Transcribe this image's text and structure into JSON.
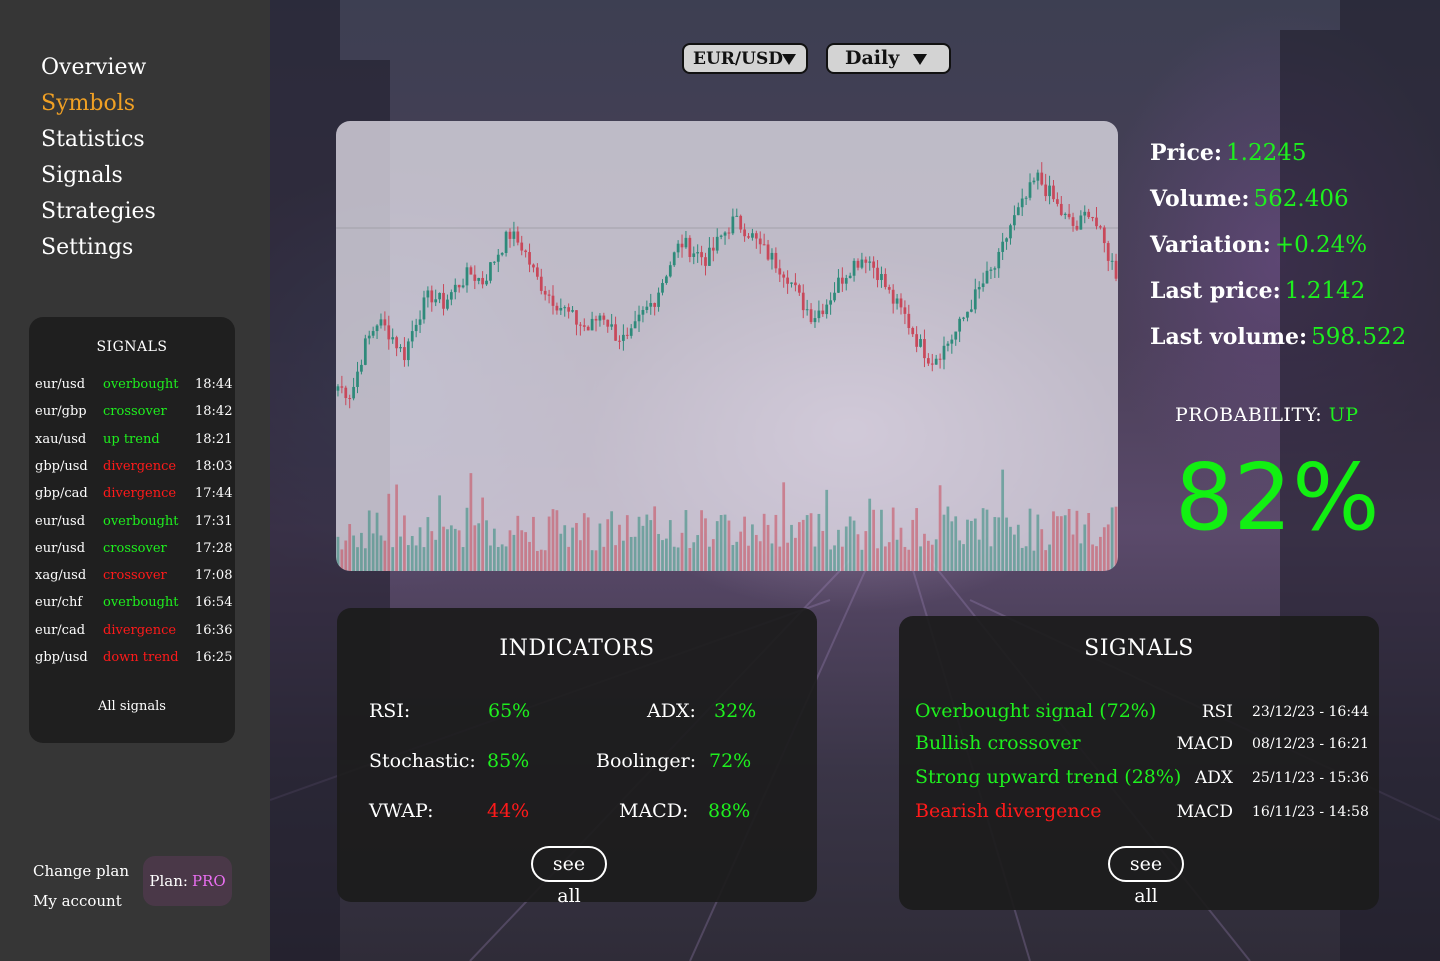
{
  "nav": {
    "items": [
      "Overview",
      "Symbols",
      "Statistics",
      "Signals",
      "Strategies",
      "Settings"
    ]
  },
  "sidebar_signals": {
    "title": "SIGNALS",
    "rows": [
      {
        "pair": "eur/usd",
        "type": "overbought",
        "time": "18:44",
        "color": "#1ef01e"
      },
      {
        "pair": "eur/gbp",
        "type": "crossover",
        "time": "18:42",
        "color": "#1ef01e"
      },
      {
        "pair": "xau/usd",
        "type": "up trend",
        "time": "18:21",
        "color": "#1ef01e"
      },
      {
        "pair": "gbp/usd",
        "type": "divergence",
        "time": "18:03",
        "color": "#ff1a1a"
      },
      {
        "pair": "gbp/cad",
        "type": "divergence",
        "time": "17:44",
        "color": "#ff1a1a"
      },
      {
        "pair": "eur/usd",
        "type": "overbought",
        "time": "17:31",
        "color": "#1ef01e"
      },
      {
        "pair": "eur/usd",
        "type": "crossover",
        "time": "17:28",
        "color": "#1ef01e"
      },
      {
        "pair": "xag/usd",
        "type": "crossover",
        "time": "17:08",
        "color": "#ff1a1a"
      },
      {
        "pair": "eur/chf",
        "type": "overbought",
        "time": "16:54",
        "color": "#1ef01e"
      },
      {
        "pair": "eur/cad",
        "type": "divergence",
        "time": "16:36",
        "color": "#ff1a1a"
      },
      {
        "pair": "gbp/usd",
        "type": "down trend",
        "time": "16:25",
        "color": "#ff1a1a"
      }
    ],
    "all_label": "All signals"
  },
  "account": {
    "change_plan": "Change plan",
    "my_account": "My account",
    "plan_label": "Plan:",
    "plan_value": "PRO"
  },
  "selectors": {
    "symbol": "EUR/USD",
    "timeframe": "Daily"
  },
  "stats": {
    "price_label": "Price:",
    "price": "1.2245",
    "volume_label": "Volume:",
    "volume": "562.406",
    "variation_label": "Variation:",
    "variation": "+0.24%",
    "last_price_label": "Last price:",
    "last_price": "1.2142",
    "last_volume_label": "Last volume:",
    "last_volume": "598.522"
  },
  "probability": {
    "label": "PROBABILITY:",
    "direction": "UP",
    "value": "82%"
  },
  "indicators": {
    "title": "INDICATORS",
    "rsi_label": "RSI:",
    "rsi": "65%",
    "adx_label": "ADX:",
    "adx": "32%",
    "stoch_label": "Stochastic:",
    "stoch": "85%",
    "boll_label": "Boolinger:",
    "boll": "72%",
    "vwap_label": "VWAP:",
    "vwap": "44%",
    "macd_label": "MACD:",
    "macd": "88%",
    "see_all": "see all"
  },
  "signals_panel": {
    "title": "SIGNALS",
    "rows": [
      {
        "text": "Overbought signal (72%)",
        "indicator": "RSI",
        "date": "23/12/23 - 16:44",
        "color": "#1ef01e"
      },
      {
        "text": "Bullish crossover",
        "indicator": "MACD",
        "date": "08/12/23 - 16:21",
        "color": "#1ef01e"
      },
      {
        "text": "Strong upward trend (28%)",
        "indicator": "ADX",
        "date": "25/11/23 - 15:36",
        "color": "#1ef01e"
      },
      {
        "text": "Bearish divergence",
        "indicator": "MACD",
        "date": "16/11/23 - 14:58",
        "color": "#ff1a1a"
      }
    ],
    "see_all": "see all"
  },
  "colors": {
    "accent": "#f0a024",
    "up": "#1ef01e",
    "down": "#ff1a1a",
    "pro": "#e96ef0"
  },
  "chart_data": {
    "type": "candlestick",
    "symbol": "EUR/USD",
    "timeframe": "1D",
    "x_count": 200,
    "close_path": [
      1.08,
      1.078,
      1.089,
      1.095,
      1.092,
      1.087,
      1.096,
      1.101,
      1.099,
      1.103,
      1.106,
      1.104,
      1.11,
      1.115,
      1.112,
      1.105,
      1.101,
      1.098,
      1.095,
      1.093,
      1.097,
      1.092,
      1.09,
      1.096,
      1.1,
      1.107,
      1.113,
      1.111,
      1.109,
      1.114,
      1.118,
      1.116,
      1.112,
      1.109,
      1.106,
      1.1,
      1.096,
      1.099,
      1.104,
      1.108,
      1.11,
      1.106,
      1.1,
      1.096,
      1.09,
      1.086,
      1.089,
      1.093,
      1.099,
      1.104,
      1.108,
      1.117,
      1.122,
      1.128,
      1.124,
      1.119,
      1.116,
      1.121,
      1.113,
      1.106
    ],
    "note": ""
  }
}
